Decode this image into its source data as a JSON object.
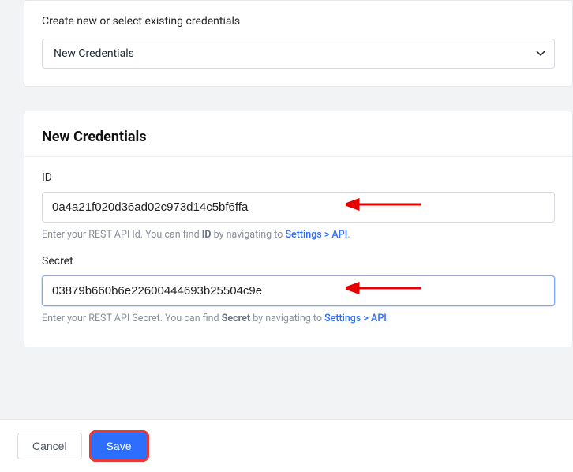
{
  "selector": {
    "title": "Create new or select existing credentials",
    "value": "New Credentials"
  },
  "credentials": {
    "heading": "New Credentials",
    "id": {
      "label": "ID",
      "value": "0a4a21f020d36ad02c973d14c5bf6ffa",
      "helper_prefix": "Enter your REST API Id. You can find ",
      "helper_bold": "ID",
      "helper_mid": " by navigating to ",
      "helper_link": "Settings > API",
      "helper_suffix": "."
    },
    "secret": {
      "label": "Secret",
      "value": "03879b660b6e22600444693b25504c9e",
      "helper_prefix": "Enter your REST API Secret. You can find ",
      "helper_bold": "Secret",
      "helper_mid": " by navigating to ",
      "helper_link": "Settings > API",
      "helper_suffix": "."
    }
  },
  "footer": {
    "cancel": "Cancel",
    "save": "Save"
  }
}
